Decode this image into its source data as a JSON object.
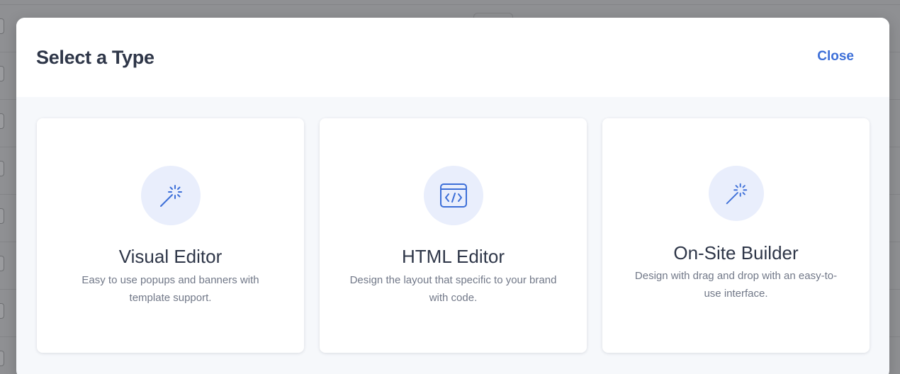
{
  "modal": {
    "title": "Select a Type",
    "close_label": "Close"
  },
  "cards": [
    {
      "title": "Visual Editor",
      "description": "Easy to use popups and banners with template support.",
      "icon": "magic-wand-icon"
    },
    {
      "title": "HTML Editor",
      "description": "Design the layout that specific to your brand with code.",
      "icon": "code-window-icon"
    },
    {
      "title": "On-Site Builder",
      "description": "Design with drag and drop with an easy-to-use interface.",
      "icon": "magic-wand-icon"
    }
  ],
  "colors": {
    "accent": "#3d6fd8",
    "icon_bg": "#e9eefc",
    "title_text": "#2e3648",
    "muted_text": "#717888"
  }
}
